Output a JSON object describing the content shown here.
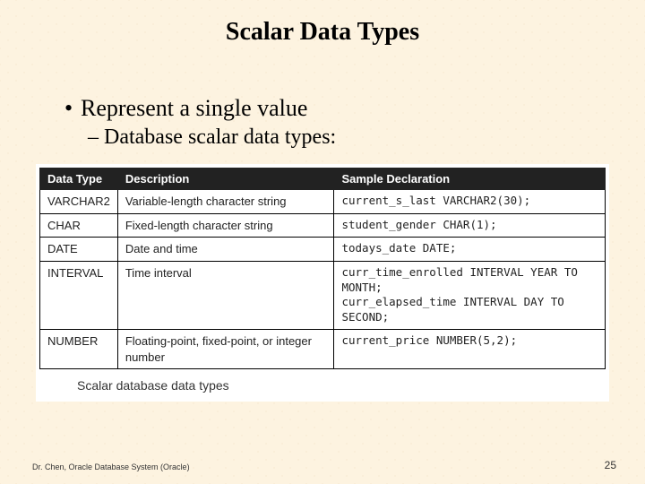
{
  "title": "Scalar Data Types",
  "bullet1": "Represent a single value",
  "bullet2": "Database scalar data types:",
  "table": {
    "headers": [
      "Data Type",
      "Description",
      "Sample Declaration"
    ],
    "rows": [
      {
        "type": "VARCHAR2",
        "desc": "Variable-length character string",
        "sample": "current_s_last VARCHAR2(30);"
      },
      {
        "type": "CHAR",
        "desc": "Fixed-length character string",
        "sample": "student_gender CHAR(1);"
      },
      {
        "type": "DATE",
        "desc": "Date and time",
        "sample": "todays_date DATE;"
      },
      {
        "type": "INTERVAL",
        "desc": "Time interval",
        "sample": "curr_time_enrolled INTERVAL YEAR TO MONTH;\ncurr_elapsed_time INTERVAL DAY TO SECOND;"
      },
      {
        "type": "NUMBER",
        "desc": "Floating-point, fixed-point, or integer number",
        "sample": "current_price NUMBER(5,2);"
      }
    ],
    "caption": "Scalar database data types"
  },
  "footer": {
    "left": "Dr. Chen, Oracle Database System (Oracle)",
    "right": "25"
  }
}
